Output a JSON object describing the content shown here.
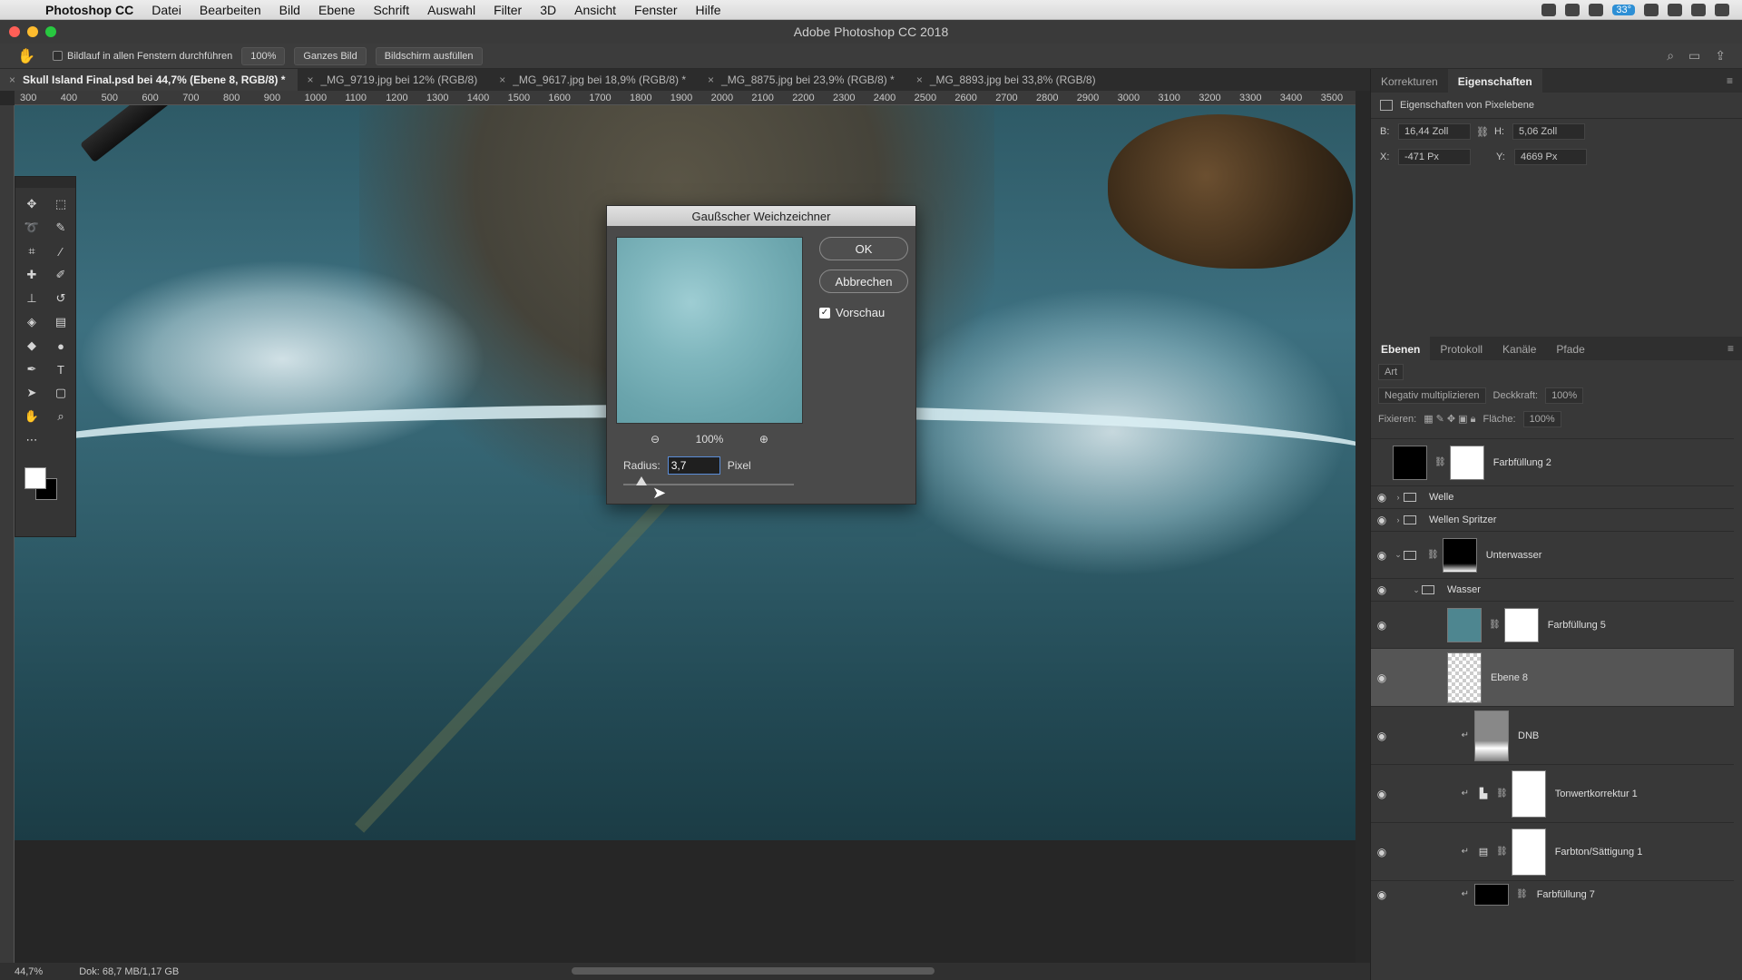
{
  "menubar": {
    "app": "Photoshop CC",
    "items": [
      "Datei",
      "Bearbeiten",
      "Bild",
      "Ebene",
      "Schrift",
      "Auswahl",
      "Filter",
      "3D",
      "Ansicht",
      "Fenster",
      "Hilfe"
    ],
    "battery_badge": "33°"
  },
  "window": {
    "title": "Adobe Photoshop CC 2018"
  },
  "options": {
    "scroll_all": "Bildlauf in allen Fenstern durchführen",
    "zoom_100": "100%",
    "fit_screen": "Ganzes Bild",
    "fill_screen": "Bildschirm ausfüllen"
  },
  "tabs": [
    {
      "label": "Skull Island Final.psd bei 44,7% (Ebene 8, RGB/8) *"
    },
    {
      "label": "_MG_9719.jpg bei 12% (RGB/8)"
    },
    {
      "label": "_MG_9617.jpg bei 18,9% (RGB/8) *"
    },
    {
      "label": "_MG_8875.jpg bei 23,9% (RGB/8) *"
    },
    {
      "label": "_MG_8893.jpg bei 33,8% (RGB/8)"
    }
  ],
  "ruler": [
    "300",
    "400",
    "500",
    "600",
    "700",
    "800",
    "900",
    "1000",
    "1100",
    "1200",
    "1300",
    "1400",
    "1500",
    "1600",
    "1700",
    "1800",
    "1900",
    "2000",
    "2100",
    "2200",
    "2300",
    "2400",
    "2500",
    "2600",
    "2700",
    "2800",
    "2900",
    "3000",
    "3100",
    "3200",
    "3300",
    "3400",
    "3500"
  ],
  "dialog": {
    "title": "Gaußscher Weichzeichner",
    "ok": "OK",
    "cancel": "Abbrechen",
    "preview": "Vorschau",
    "zoom": "100%",
    "radius_label": "Radius:",
    "radius_value": "3,7",
    "unit": "Pixel"
  },
  "properties": {
    "tabs": [
      "Korrekturen",
      "Eigenschaften"
    ],
    "subtitle": "Eigenschaften von Pixelebene",
    "w_label": "B:",
    "w": "16,44 Zoll",
    "h_label": "H:",
    "h": "5,06 Zoll",
    "x_label": "X:",
    "x": "-471 Px",
    "y_label": "Y:",
    "y": "4669 Px"
  },
  "layers_panel": {
    "tabs": [
      "Ebenen",
      "Protokoll",
      "Kanäle",
      "Pfade"
    ],
    "filter": "Art",
    "blend": "Negativ multiplizieren",
    "opacity_label": "Deckkraft:",
    "opacity": "100%",
    "lock_label": "Fixieren:",
    "fill_label": "Fläche:",
    "fill": "100%",
    "layers": [
      {
        "name": "Farbfüllung 2"
      },
      {
        "name": "Welle"
      },
      {
        "name": "Wellen Spritzer"
      },
      {
        "name": "Unterwasser"
      },
      {
        "name": "Wasser"
      },
      {
        "name": "Farbfüllung 5"
      },
      {
        "name": "Ebene 8"
      },
      {
        "name": "DNB"
      },
      {
        "name": "Tonwertkorrektur 1"
      },
      {
        "name": "Farbton/Sättigung 1"
      },
      {
        "name": "Farbfüllung 7"
      }
    ]
  },
  "status": {
    "zoom": "44,7%",
    "doc": "Dok: 68,7 MB/1,17 GB"
  }
}
